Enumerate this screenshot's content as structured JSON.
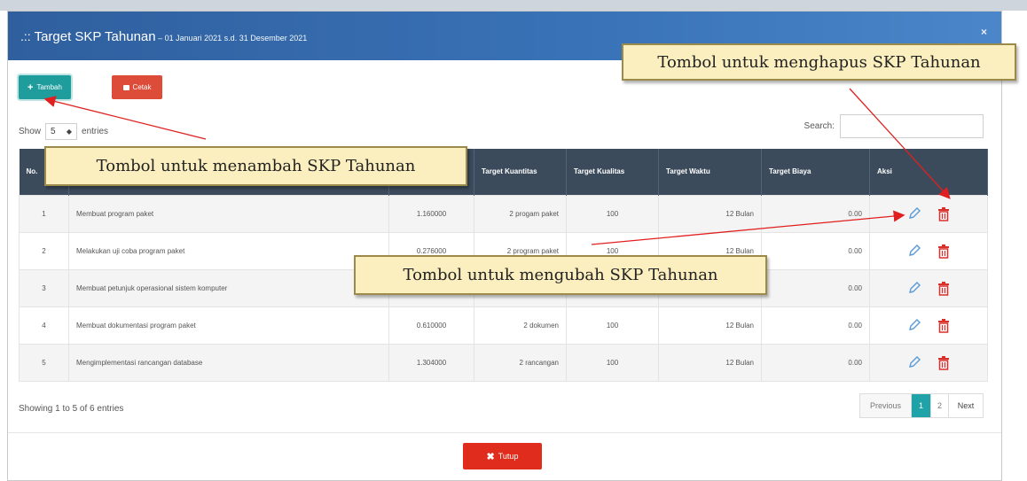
{
  "modal": {
    "title_prefix": ".:: ",
    "title": "Target SKP Tahunan",
    "subtitle": " – 01 Januari 2021 s.d. 31 Desember 2021",
    "close_label": "×"
  },
  "toolbar": {
    "add_label": "Tambah",
    "print_label": "Cetak"
  },
  "length_menu": {
    "show_label": "Show",
    "value": "5",
    "entries_label": "entries"
  },
  "search": {
    "label": "Search:",
    "value": ""
  },
  "table": {
    "columns": [
      "No.",
      "",
      "",
      "Target Kuantitas",
      "Target Kualitas",
      "Target Waktu",
      "Target Biaya",
      "Aksi"
    ],
    "rows": [
      {
        "no": "1",
        "kegiatan": "Membuat program paket",
        "ak": "1.160000",
        "kuantitas": "2 progam paket",
        "kualitas": "100",
        "waktu": "12 Bulan",
        "biaya": "0.00"
      },
      {
        "no": "2",
        "kegiatan": "Melakukan uji coba program paket",
        "ak": "0.276000",
        "kuantitas": "2 program paket",
        "kualitas": "100",
        "waktu": "12 Bulan",
        "biaya": "0.00"
      },
      {
        "no": "3",
        "kegiatan": "Membuat petunjuk operasional sistem komputer",
        "ak": "",
        "kuantitas": "",
        "kualitas": "",
        "waktu": "",
        "biaya": "0.00"
      },
      {
        "no": "4",
        "kegiatan": "Membuat dokumentasi program paket",
        "ak": "0.610000",
        "kuantitas": "2 dokumen",
        "kualitas": "100",
        "waktu": "12 Bulan",
        "biaya": "0.00"
      },
      {
        "no": "5",
        "kegiatan": "Mengimplementasi rancangan database",
        "ak": "1.304000",
        "kuantitas": "2 rancangan",
        "kualitas": "100",
        "waktu": "12 Bulan",
        "biaya": "0.00"
      }
    ]
  },
  "info": {
    "showing": "Showing 1 to 5 of 6 entries"
  },
  "pagination": {
    "previous": "Previous",
    "pages": [
      "1",
      "2"
    ],
    "next": "Next",
    "active_page": "1"
  },
  "footer": {
    "close_label": "Tutup"
  },
  "annotations": {
    "delete_note": "Tombol untuk menghapus SKP Tahunan",
    "add_note": "Tombol untuk menambah SKP Tahunan",
    "edit_note": "Tombol untuk mengubah SKP Tahunan"
  },
  "icons": {
    "add": "plus-icon",
    "print": "print-icon",
    "edit": "pencil-icon",
    "delete": "trash-icon",
    "close": "times-icon"
  },
  "colors": {
    "header_bg": "#3a73b8",
    "table_header": "#3c4b5c",
    "add_button": "#1f9d9c",
    "print_button": "#dd4b39",
    "close_button": "#e02c1c",
    "edit_icon": "#5b9bd5",
    "delete_icon": "#d9302c",
    "callout_bg": "#fbefbf",
    "arrow": "#e02020"
  }
}
